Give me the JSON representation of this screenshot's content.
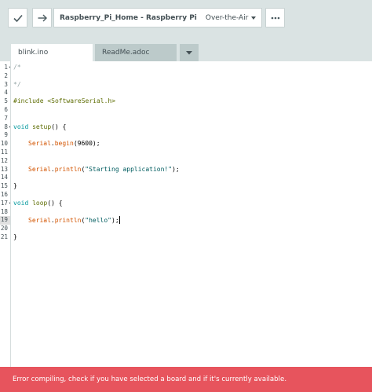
{
  "toolbar": {
    "verify_icon": "checkmark-icon",
    "upload_icon": "right-arrow-icon",
    "board_name": "Raspberry_Pi_Home - Raspberry Pi",
    "port": "Over-the-Air",
    "more_icon": "ellipsis-icon"
  },
  "tabs": [
    {
      "label": "blink.ino",
      "active": true
    },
    {
      "label": "ReadMe.adoc",
      "active": false
    }
  ],
  "tab_menu_icon": "chevron-down-icon",
  "editor": {
    "line_numbers": [
      "1",
      "2",
      "3",
      "4",
      "5",
      "6",
      "7",
      "8",
      "9",
      "10",
      "11",
      "12",
      "13",
      "14",
      "15",
      "16",
      "17",
      "18",
      "19",
      "20",
      "21"
    ],
    "current_line": 19,
    "code": {
      "l1": "/*",
      "l3": "*/",
      "l5": "#include <SoftwareSerial.h>",
      "l8_type": "void",
      "l8_func": "setup",
      "l8_rest": "() {",
      "l10_obj": "Serial",
      "l10_dot": ".",
      "l10_func": "begin",
      "l10_rest": "(9600);",
      "l13_obj": "Serial",
      "l13_dot": ".",
      "l13_func": "println",
      "l13_open": "(",
      "l13_str": "\"Starting application!\"",
      "l13_close": ");",
      "l15": "}",
      "l17_type": "void",
      "l17_func": "loop",
      "l17_rest": "() {",
      "l19_obj": "Serial",
      "l19_dot": ".",
      "l19_func": "println",
      "l19_open": "(",
      "l19_str": "\"hello\"",
      "l19_close": ");",
      "l21": "}"
    }
  },
  "status": {
    "message": "Error compiling, check if you have selected a board and if it's currently available.",
    "color": "#e7545d"
  }
}
